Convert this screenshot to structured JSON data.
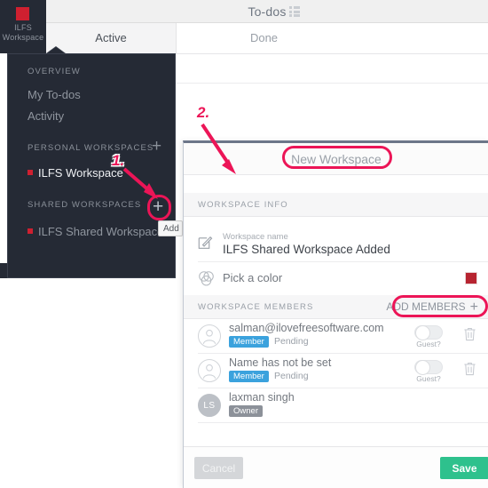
{
  "app": {
    "header_title": "To-dos",
    "grid_icon": "grid-view-icon",
    "logo": {
      "name_line1": "ILFS",
      "name_line2": "Workspace",
      "color": "#cf2030"
    },
    "tabs": [
      {
        "label": "Active",
        "active": true
      },
      {
        "label": "Done",
        "active": false
      }
    ]
  },
  "sidebar": {
    "sections": [
      {
        "title": "OVERVIEW"
      },
      {
        "title": "PERSONAL WORKSPACES"
      },
      {
        "title": "SHARED WORKSPACES"
      }
    ],
    "overview_items": [
      {
        "label": "My To-dos"
      },
      {
        "label": "Activity"
      }
    ],
    "personal_workspaces": [
      {
        "label": "ILFS Workspace",
        "dot_color": "#cf2030"
      }
    ],
    "shared_workspaces": [
      {
        "label": "ILFS Shared Workspace",
        "dot_color": "#cf2030"
      }
    ],
    "add_personal_icon": "plus-icon",
    "add_shared_icon": "plus-icon",
    "tooltip": "Add"
  },
  "dialog": {
    "title": "New Workspace",
    "info_section_title": "WORKSPACE INFO",
    "workspace_name": {
      "icon": "edit-pencil-icon",
      "label": "Workspace name",
      "value": "ILFS Shared Workspace Added"
    },
    "color": {
      "icon": "color-circles-icon",
      "label": "Pick a color",
      "swatch": "#b72430"
    },
    "members_section_title": "WORKSPACE MEMBERS",
    "add_members": {
      "label": "Add Members",
      "icon": "plus-icon"
    },
    "members": [
      {
        "name": "salman@ilovefreesoftware.com",
        "badge": "Member",
        "badge_type": "member",
        "status": "Pending",
        "avatar_initials": "",
        "avatar_type": "outline",
        "toggle_label": "Guest?",
        "toggle_on": false,
        "delete_icon": "trash-icon"
      },
      {
        "name": "Name has not be set",
        "badge": "Member",
        "badge_type": "member",
        "status": "Pending",
        "avatar_initials": "",
        "avatar_type": "outline",
        "toggle_label": "Guest?",
        "toggle_on": false,
        "delete_icon": "trash-icon"
      },
      {
        "name": "laxman singh",
        "badge": "Owner",
        "badge_type": "owner",
        "status": "",
        "avatar_initials": "LS",
        "avatar_type": "filled",
        "toggle_label": "",
        "toggle_on": false,
        "delete_icon": ""
      }
    ],
    "footer": {
      "cancel_label": "Cancel",
      "save_label": "Save",
      "save_color": "#2ec18d"
    }
  },
  "annotations": {
    "marker_1": "1.",
    "marker_2": "2.",
    "highlight_color": "#ec1557"
  }
}
